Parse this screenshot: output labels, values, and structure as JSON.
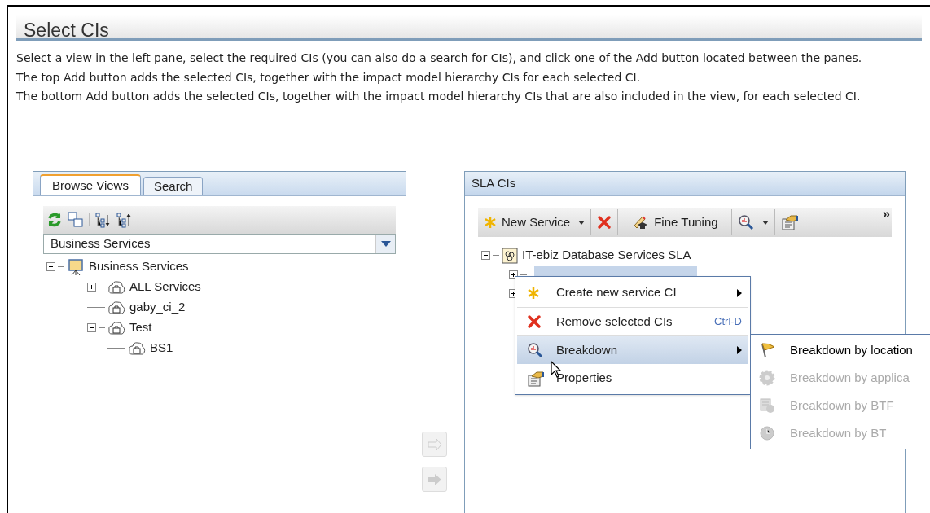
{
  "page": {
    "title": "Select CIs"
  },
  "description": [
    "Select a view in the left pane, select the required CIs (you can also do a search for CIs), and click one of the Add button located between the panes.",
    "The top Add button adds the selected CIs, together with the impact model hierarchy CIs for each selected CI.",
    "The bottom Add button adds the selected CIs, together with the impact model hierarchy CIs that are also included in the view, for each selected CI."
  ],
  "left_pane": {
    "tabs": [
      {
        "label": "Browse Views",
        "selected": true
      },
      {
        "label": "Search",
        "selected": false
      }
    ],
    "view_select": {
      "value": "Business Services"
    },
    "tree": [
      {
        "label": "Business Services",
        "kind": "view",
        "expanded": true,
        "children": [
          {
            "label": "ALL Services",
            "expanded": false
          },
          {
            "label": "gaby_ci_2"
          },
          {
            "label": "Test",
            "expanded": true,
            "children": [
              {
                "label": "BS1"
              }
            ]
          }
        ]
      }
    ]
  },
  "transfer_buttons": [
    {
      "kind": "add",
      "disabled": true
    },
    {
      "kind": "add_view",
      "disabled": true
    }
  ],
  "right_pane": {
    "title": "SLA CIs",
    "toolbar": [
      {
        "kind": "new",
        "label": "New Service"
      },
      {
        "kind": "delete"
      },
      {
        "kind": "tune",
        "label": "Fine Tuning"
      },
      {
        "kind": "breakdown"
      },
      {
        "kind": "properties"
      },
      {
        "kind": "more",
        "label": "»"
      }
    ],
    "tree": [
      {
        "label": "IT-ebiz Database Services SLA",
        "expanded": true,
        "children": [
          {
            "expanded": false,
            "selected": true
          },
          {
            "expanded": false
          }
        ]
      }
    ],
    "context_menu": [
      {
        "kind": "new",
        "label": "Create new service CI",
        "submenu": true,
        "highlighted": false
      },
      {
        "kind": "delete",
        "label": "Remove selected CIs",
        "shortcut": "Ctrl-D",
        "highlighted": false
      },
      {
        "kind": "breakdown",
        "label": "Breakdown",
        "submenu": true,
        "highlighted": true
      },
      {
        "kind": "properties",
        "label": "Properties",
        "highlighted": false
      }
    ],
    "submenu": [
      {
        "kind": "location",
        "label": "Breakdown by location",
        "disabled": false
      },
      {
        "kind": "application",
        "label": "Breakdown by applica",
        "disabled": true
      },
      {
        "kind": "btf",
        "label": "Breakdown by BTF",
        "disabled": true
      },
      {
        "kind": "bt",
        "label": "Breakdown by BT",
        "disabled": true
      }
    ]
  }
}
